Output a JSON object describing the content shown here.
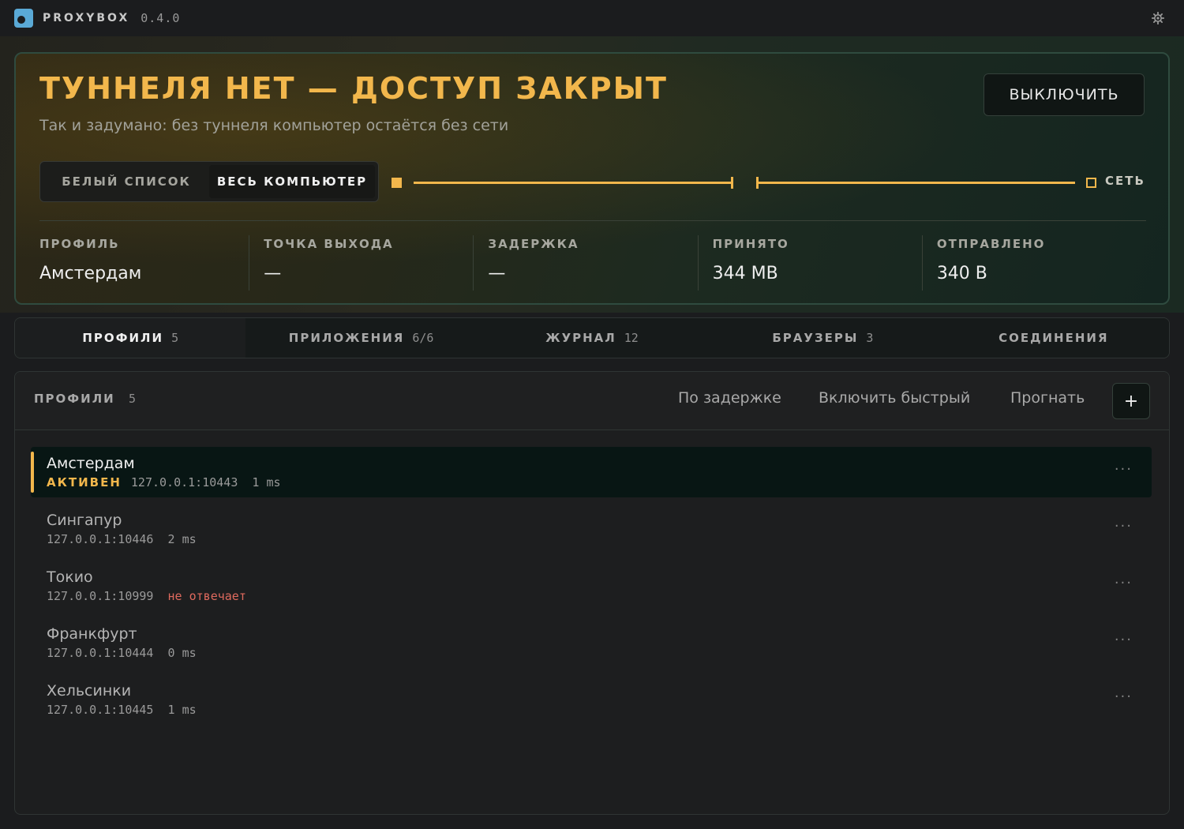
{
  "app": {
    "name": "PROXYBOX",
    "version": "0.4.0"
  },
  "hero": {
    "title": "ТУННЕЛЯ НЕТ — ДОСТУП ЗАКРЫТ",
    "subtitle": "Так и задумано: без туннеля компьютер остаётся без сети",
    "off_button": "ВЫКЛЮЧИТЬ",
    "modes": [
      {
        "label": "БЕЛЫЙ СПИСОК",
        "active": false
      },
      {
        "label": "ВЕСЬ КОМПЬЮТЕР",
        "active": true
      }
    ],
    "route_end_label": "СЕТЬ",
    "stats": [
      {
        "label": "ПРОФИЛЬ",
        "value": "Амстердам"
      },
      {
        "label": "ТОЧКА ВЫХОДА",
        "value": "—"
      },
      {
        "label": "ЗАДЕРЖКА",
        "value": "—"
      },
      {
        "label": "ПРИНЯТО",
        "value": "344 MB"
      },
      {
        "label": "ОТПРАВЛЕНО",
        "value": "340 B"
      }
    ],
    "accent_color": "#f2b74c"
  },
  "tabs": [
    {
      "label": "ПРОФИЛИ",
      "count": "5",
      "active": true
    },
    {
      "label": "ПРИЛОЖЕНИЯ",
      "count": "6/6",
      "active": false
    },
    {
      "label": "ЖУРНАЛ",
      "count": "12",
      "active": false
    },
    {
      "label": "БРАУЗЕРЫ",
      "count": "3",
      "active": false
    },
    {
      "label": "СОЕДИНЕНИЯ",
      "count": "",
      "active": false
    }
  ],
  "profiles_panel": {
    "title": "ПРОФИЛИ",
    "count": "5",
    "sort_button": "По задержке",
    "fast_button": "Включить быстрый",
    "run_button": "Прогнать",
    "add_button": "+",
    "items": [
      {
        "name": "Амстердам",
        "status": "АКТИВЕН",
        "address": "127.0.0.1:10443",
        "latency": "1 ms",
        "active": true,
        "error": false
      },
      {
        "name": "Сингапур",
        "status": "",
        "address": "127.0.0.1:10446",
        "latency": "2 ms",
        "active": false,
        "error": false
      },
      {
        "name": "Токио",
        "status": "",
        "address": "127.0.0.1:10999",
        "latency": "не отвечает",
        "active": false,
        "error": true
      },
      {
        "name": "Франкфурт",
        "status": "",
        "address": "127.0.0.1:10444",
        "latency": "0 ms",
        "active": false,
        "error": false
      },
      {
        "name": "Хельсинки",
        "status": "",
        "address": "127.0.0.1:10445",
        "latency": "1 ms",
        "active": false,
        "error": false
      }
    ],
    "menu_glyph": "···"
  },
  "icons": {
    "app": "app-logo-icon",
    "settings": "gear-icon"
  }
}
